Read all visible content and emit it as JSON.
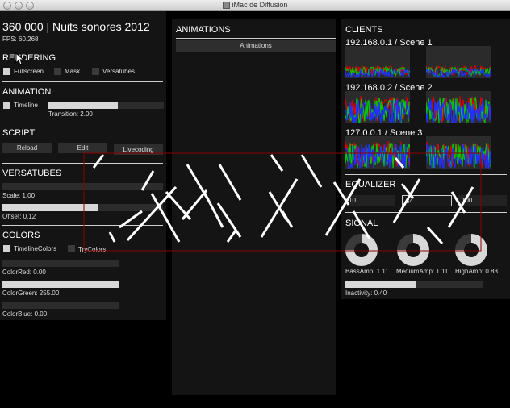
{
  "window": {
    "title": "iMac de Diffusion"
  },
  "left": {
    "title": "360 000 | Nuits sonores 2012",
    "fps": "FPS: 60.268",
    "rendering": {
      "heading": "RENDERING",
      "fullscreen": "Fullscreen",
      "mask": "Mask",
      "versatubes": "Versatubes"
    },
    "animation": {
      "heading": "ANIMATION",
      "timeline": "Timeline",
      "transition": "Transition: 2.00",
      "transition_fraction": 0.6
    },
    "script": {
      "heading": "SCRIPT",
      "reload": "Reload",
      "edit": "Edit",
      "livecoding": "Livecoding"
    },
    "versatubes": {
      "heading": "VERSATUBES",
      "scale": "Scale: 1.00",
      "scale_fraction": 0.0,
      "offset": "Offset: 0.12",
      "offset_fraction": 0.6
    },
    "colors": {
      "heading": "COLORS",
      "timeline_colors": "TimelineColors",
      "try_colors": "TryColors",
      "red": "ColorRed: 0.00",
      "red_fraction": 0.0,
      "green": "ColorGreen: 255.00",
      "green_fraction": 1.0,
      "blue": "ColorBlue: 0.00",
      "blue_fraction": 0.0
    }
  },
  "middle": {
    "heading": "ANIMATIONS",
    "animations_button": "Animations"
  },
  "right": {
    "clients_heading": "CLIENTS",
    "clients": [
      {
        "label": "192.168.0.1 / Scene 1"
      },
      {
        "label": "192.168.0.2 / Scene 2"
      },
      {
        "label": "127.0.0.1 / Scene 3"
      }
    ],
    "equalizer": {
      "heading": "EQUALIZER",
      "values": [
        "10",
        "34",
        "100"
      ]
    },
    "signal": {
      "heading": "SIGNAL",
      "bass": "BassAmp: 1.11",
      "bass_level": 0.75,
      "medium": "MediumAmp: 1.11",
      "medium_level": 0.75,
      "high": "HighAmp: 0.83",
      "high_level": 0.75,
      "inactivity": "Inactivity: 0.40",
      "inactivity_fraction": 0.51
    }
  },
  "colors": {
    "panel": "#141414",
    "accent_red": "#e00000",
    "accent_green": "#00cc00",
    "accent_blue": "#2030ff"
  }
}
